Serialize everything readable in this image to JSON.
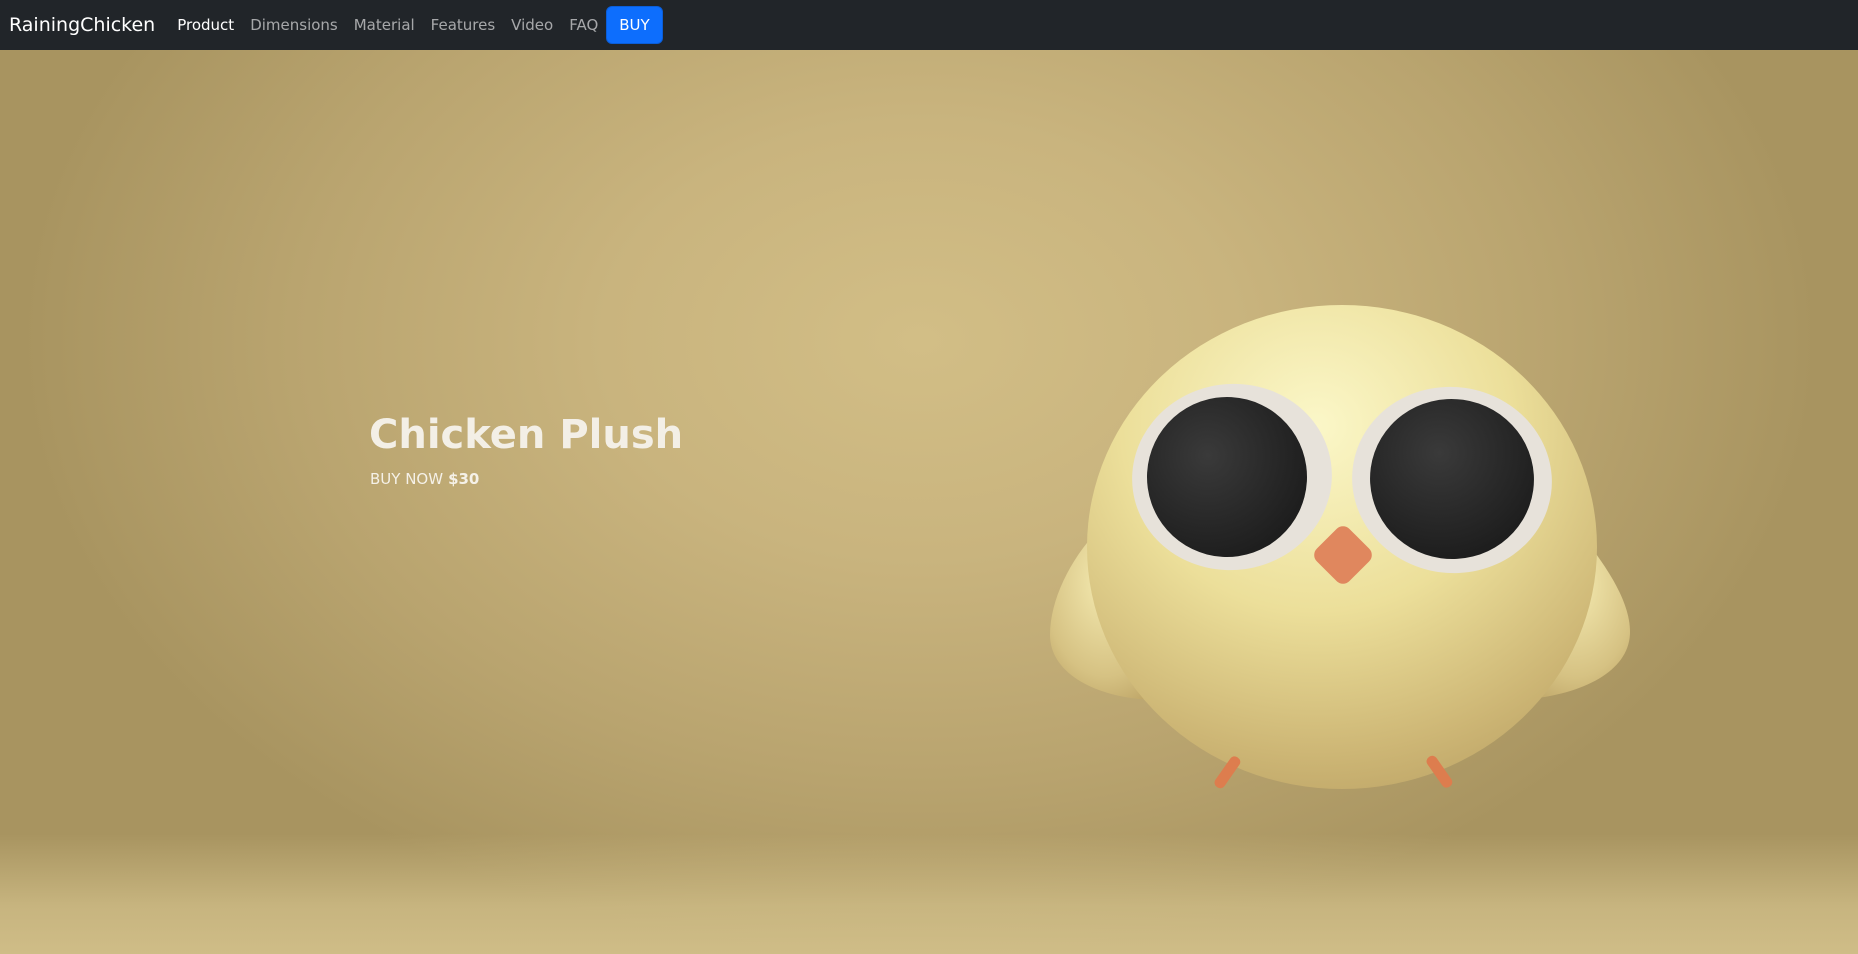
{
  "navbar": {
    "brand": "RainingChicken",
    "links": [
      "Product",
      "Dimensions",
      "Material",
      "Features",
      "Video",
      "FAQ"
    ],
    "active_link": "Product",
    "buy_label": "BUY"
  },
  "hero": {
    "title": "Chicken Plush",
    "cta_prefix": "BUY NOW",
    "price": "$30",
    "illustration": "chicken-plush-3d"
  },
  "colors": {
    "navbar_bg": "#212529",
    "accent": "#0d6efd",
    "background": "#c9b47e",
    "chick_body": "#ecdf9a",
    "beak": "#e0875e"
  }
}
